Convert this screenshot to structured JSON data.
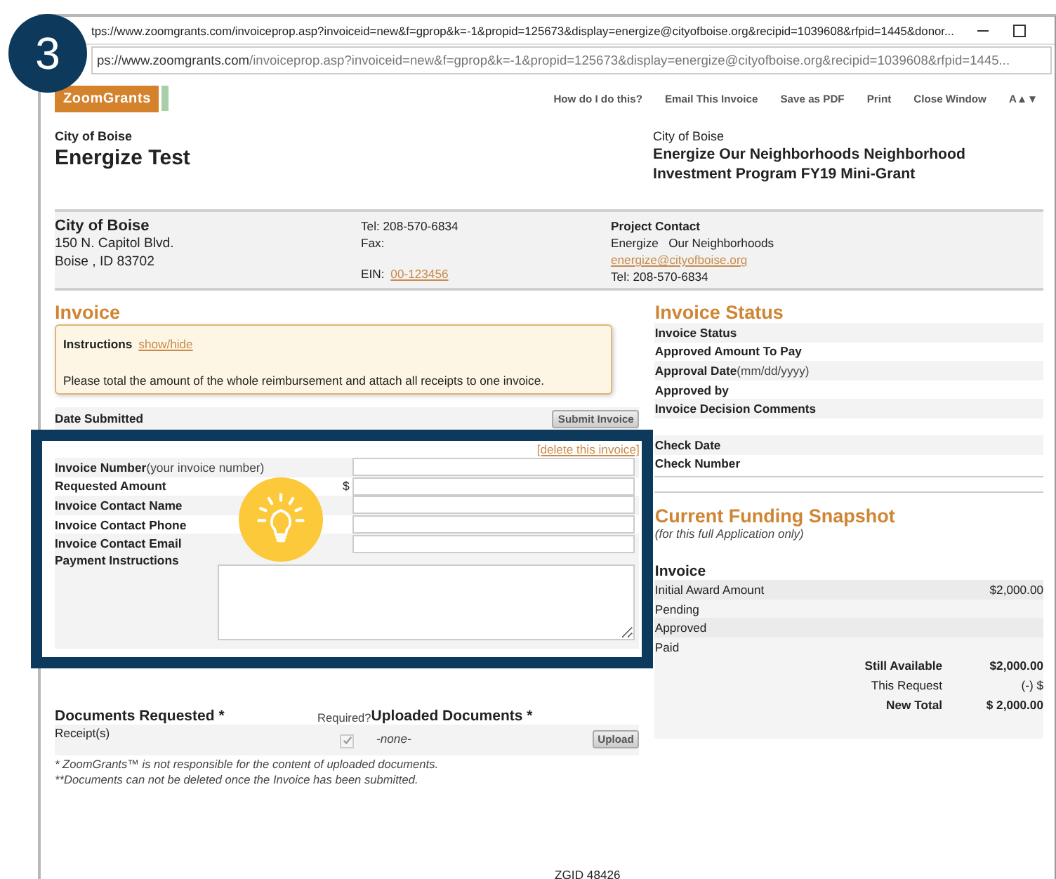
{
  "step_badge": "3",
  "browser": {
    "title": "tps://www.zoomgrants.com/invoiceprop.asp?invoiceid=new&f=gprop&k=-1&propid=125673&display=energize@cityofboise.org&recipid=1039608&rfpid=1445&donor...",
    "address_host": "ps://www.zoomgrants.com",
    "address_path": "/invoiceprop.asp?invoiceid=new&f=gprop&k=-1&propid=125673&display=energize@cityofboise.org&recipid=1039608&rfpid=1445..."
  },
  "logo": "ZoomGrants",
  "nav_links": [
    "How do I do this?",
    "Email This Invoice",
    "Save as PDF",
    "Print",
    "Close Window",
    "A▲▼"
  ],
  "header": {
    "org": "City of Boise",
    "title": "Energize Test",
    "program_org": "City of Boise",
    "program_title": "Energize Our Neighborhoods Neighborhood Investment Program FY19 Mini-Grant"
  },
  "applicant": {
    "name": "City of Boise",
    "address_lines": [
      "150 N. Capitol Blvd.",
      "Boise , ID   83702"
    ],
    "tel": "Tel: 208-570-6834",
    "fax": "Fax:",
    "ein_label": "EIN:",
    "ein": "00-123456",
    "contact_heading": "Project Contact",
    "contact_name": "Energize   Our Neighborhoods",
    "contact_email": "energize@cityofboise.org",
    "contact_tel": "Tel: 208-570-6834"
  },
  "invoice": {
    "heading": "Invoice",
    "instructions_label": "Instructions",
    "instructions_link": "show/hide",
    "instructions_text": "Please total the amount of the whole reimbursement and attach all receipts to one invoice.",
    "date_submitted_label": "Date Submitted",
    "submit_button": "Submit Invoice",
    "delete_link": "[delete this invoice]",
    "fields": [
      {
        "kind": "input",
        "label": "Invoice Number",
        "hint": "(your invoice number)"
      },
      {
        "kind": "input",
        "label": "Requested Amount",
        "prefix": "$"
      },
      {
        "kind": "input",
        "label": "Invoice Contact Name"
      },
      {
        "kind": "input",
        "label": "Invoice Contact Phone"
      },
      {
        "kind": "input",
        "label": "Invoice Contact Email"
      },
      {
        "kind": "textarea",
        "label": "Payment Instructions"
      }
    ]
  },
  "documents": {
    "heading": "Documents Requested *",
    "required_heading": "Required?",
    "uploaded_heading": "Uploaded Documents *",
    "rows": [
      {
        "name": "Receipt(s)",
        "required": true,
        "uploaded": "-none-",
        "upload_button": "Upload"
      }
    ]
  },
  "footnotes": [
    "* ZoomGrants™ is not responsible for the content of uploaded documents.",
    "**Documents can not be deleted once the Invoice has been submitted."
  ],
  "zgid": "ZGID 48426",
  "status": {
    "heading": "Invoice Status",
    "rows": [
      {
        "label": "Invoice Status"
      },
      {
        "label": "Approved Amount To Pay"
      },
      {
        "label": "Approval Date",
        "hint": "(mm/dd/yyyy)"
      },
      {
        "label": "Approved by"
      },
      {
        "label": "Invoice Decision Comments"
      }
    ],
    "check_rows": [
      "Check Date",
      "Check Number"
    ]
  },
  "snapshot": {
    "heading": "Current Funding Snapshot",
    "subtitle": "(for this full Application only)",
    "section": "Invoice",
    "rows": [
      {
        "label": "Initial Award Amount",
        "value": "$2,000.00"
      },
      {
        "label": "Pending"
      },
      {
        "label": "Approved"
      },
      {
        "label": "Paid"
      }
    ],
    "totals": [
      {
        "label": "Still Available",
        "value": "$2,000.00",
        "bold": true
      },
      {
        "label": "This Request",
        "value": "(-) $",
        "bold": false
      },
      {
        "label": "New Total",
        "value": "$ 2,000.00",
        "bold": true
      }
    ]
  }
}
